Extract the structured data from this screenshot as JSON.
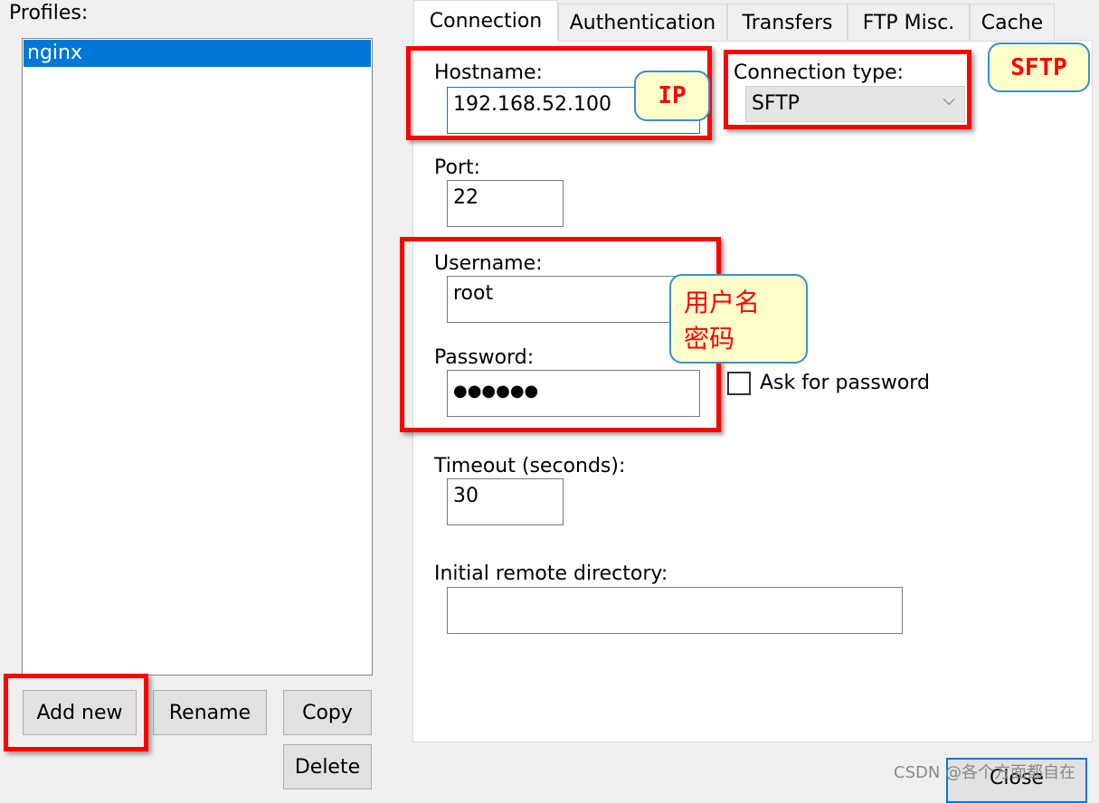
{
  "profiles": {
    "label": "Profiles:",
    "items": [
      "nginx"
    ],
    "selected": 0
  },
  "buttons": {
    "add_new": "Add new",
    "rename": "Rename",
    "copy": "Copy",
    "delete": "Delete",
    "close": "Close"
  },
  "tabs": [
    "Connection",
    "Authentication",
    "Transfers",
    "FTP Misc.",
    "Cache"
  ],
  "active_tab": 0,
  "form": {
    "hostname_label": "Hostname:",
    "hostname": "192.168.52.100",
    "conn_type_label": "Connection type:",
    "conn_type": "SFTP",
    "port_label": "Port:",
    "port": "22",
    "username_label": "Username:",
    "username": "root",
    "password_label": "Password:",
    "password": "●●●●●●",
    "ask_password": "Ask for password",
    "ask_password_checked": false,
    "timeout_label": "Timeout (seconds):",
    "timeout": "30",
    "remote_dir_label": "Initial remote directory:",
    "remote_dir": ""
  },
  "annotations": {
    "ip": "IP",
    "sftp": "SFTP",
    "user_pass": "用户名\n密码"
  },
  "watermark": "CSDN @各个方面都自在",
  "colors": {
    "selection": "#0078d7",
    "highlight": "#ff0000",
    "note_bg": "#ffffcc"
  }
}
